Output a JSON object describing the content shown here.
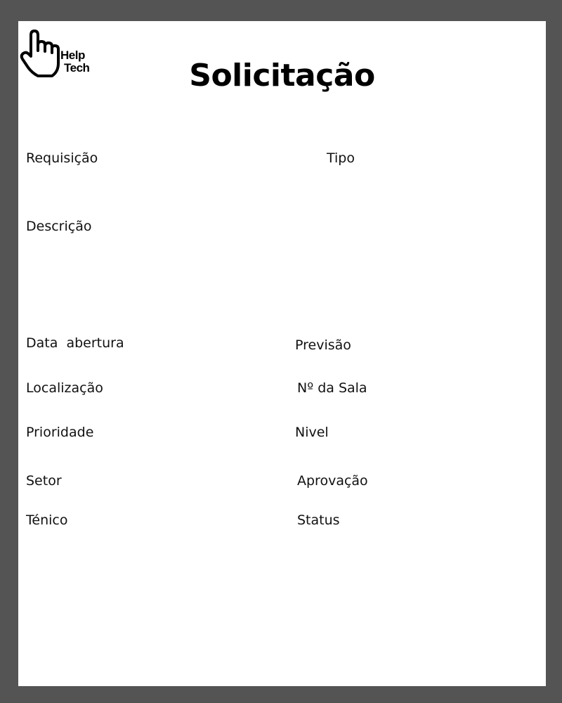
{
  "title": "Solicitação",
  "logo": {
    "icon": "pointing-hand-icon",
    "line1": "Help",
    "line2": "Tech"
  },
  "fields": {
    "requisicao": "Requisição",
    "tipo": "Tipo",
    "descricao": "Descrição",
    "data_abertura": "Data  abertura",
    "previsao": "Previsão",
    "localizacao": "Localização",
    "numero_sala": "Nº da Sala",
    "prioridade": "Prioridade",
    "nivel": "Nivel",
    "setor": "Setor",
    "aprovacao": "Aprovação",
    "tecnico": "Ténico",
    "status": "Status"
  }
}
